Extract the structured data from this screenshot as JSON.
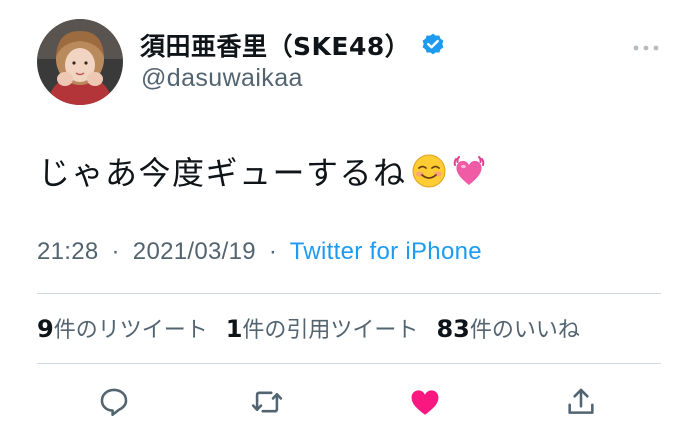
{
  "tweet": {
    "display_name": "須田亜香里（SKE48）",
    "handle": "@dasuwaikaa",
    "text": "じゃあ今度ギューするね",
    "emojis": [
      "smiling-face-icon",
      "beating-heart-icon"
    ],
    "time": "21:28",
    "separator": "·",
    "date": "2021/03/19",
    "source": "Twitter for iPhone",
    "stats": [
      {
        "count": "9",
        "label": "件のリツイート"
      },
      {
        "count": "1",
        "label": "件の引用ツイート"
      },
      {
        "count": "83",
        "label": "件のいいね"
      }
    ]
  },
  "colors": {
    "accent": "#1d9bf0",
    "secondary_text": "#536471",
    "like": "#f91880",
    "divider": "#cfd9de"
  }
}
